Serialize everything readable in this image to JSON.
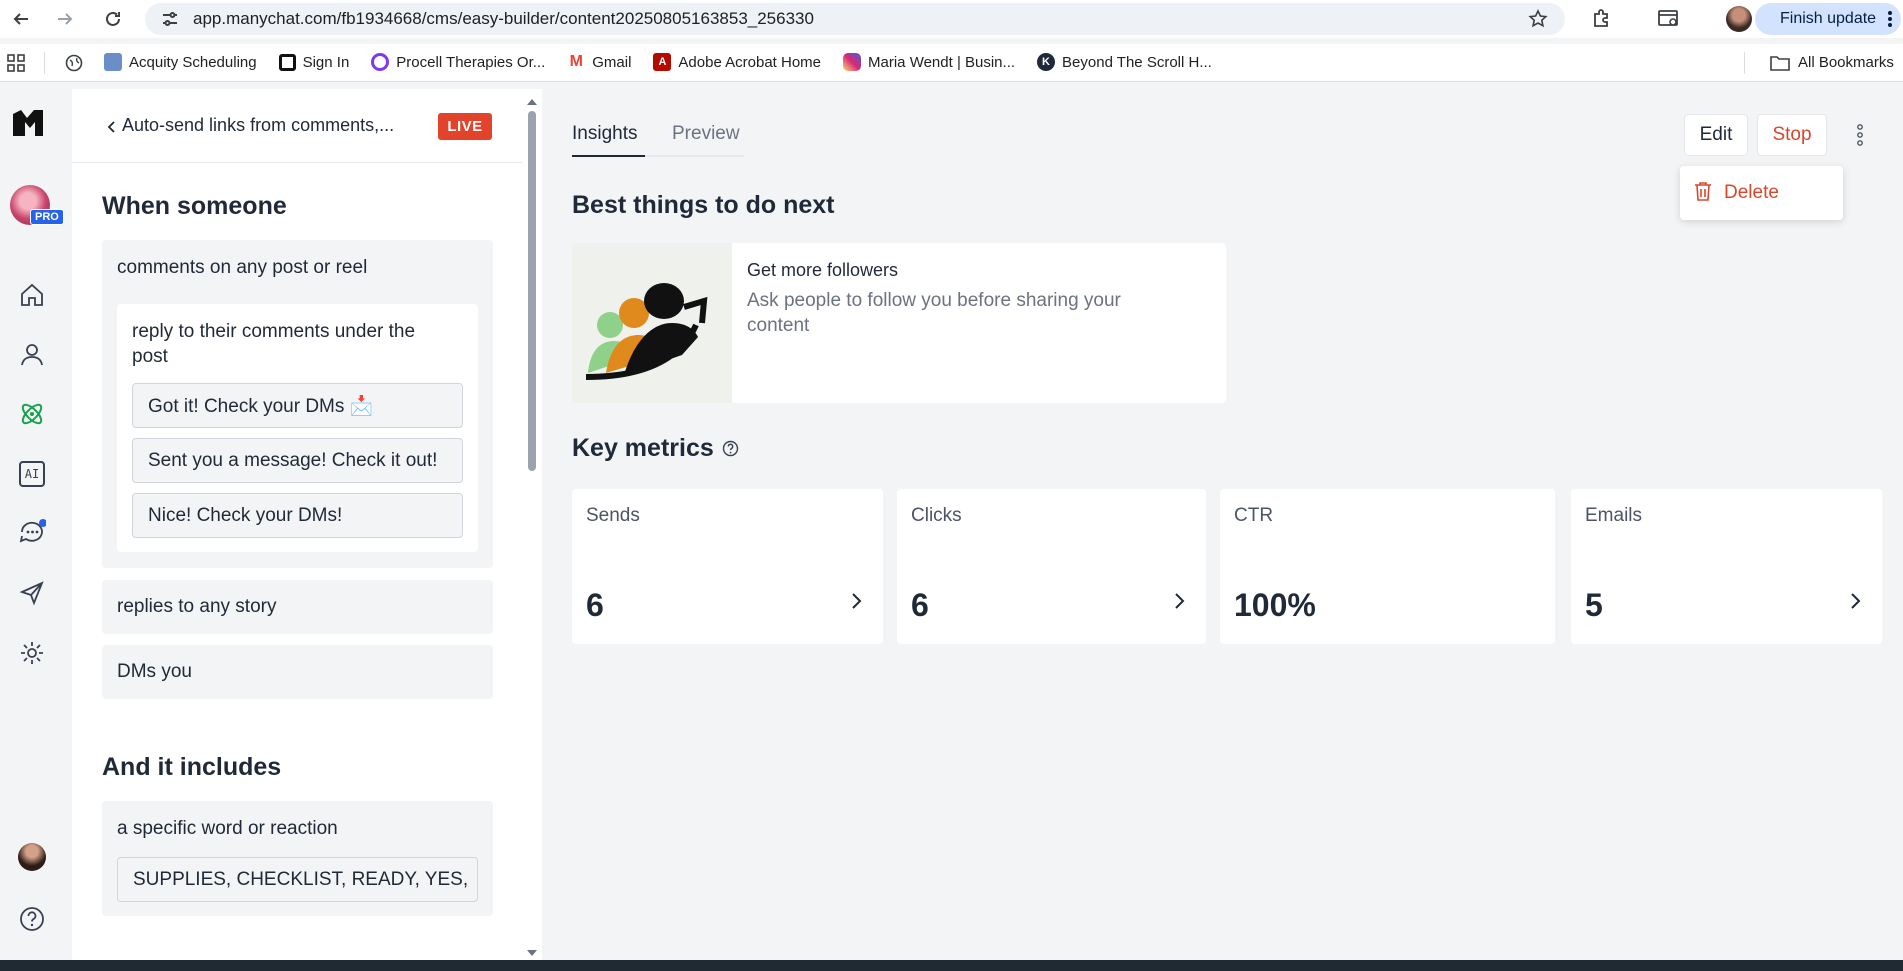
{
  "browser": {
    "url": "app.manychat.com/fb1934668/cms/easy-builder/content20250805163853_256330",
    "finish_update": "Finish update",
    "bookmarks": [
      {
        "label": "Acquity Scheduling",
        "color": "#6b8ec9"
      },
      {
        "label": "Sign In",
        "color": "#111111"
      },
      {
        "label": "Procell Therapies Or...",
        "color": "#7c3aed"
      },
      {
        "label": "Gmail",
        "color": "#ea4335"
      },
      {
        "label": "Adobe Acrobat Home",
        "color": "#b30b00"
      },
      {
        "label": "Maria Wendt | Busin...",
        "color": "#d62976"
      },
      {
        "label": "Beyond The Scroll H...",
        "color": "#1e293b"
      }
    ],
    "all_bookmarks": "All Bookmarks"
  },
  "rail": {
    "pro_badge": "PRO",
    "ai_label": "AI"
  },
  "left_panel": {
    "title": "Auto-send links from comments,...",
    "live": "LIVE",
    "when_heading": "When someone",
    "trigger_comments": "comments on any post or reel",
    "reply_heading": "reply to their comments under the post",
    "replies": [
      "Got it! Check your DMs 📩",
      "Sent you a message! Check it out!",
      "Nice! Check your DMs!"
    ],
    "trigger_story": "replies to any story",
    "trigger_dm": "DMs you",
    "includes_heading": "And it includes",
    "includes_text": "a specific word or reaction",
    "keywords": "SUPPLIES, CHECKLIST, READY, YES,"
  },
  "main": {
    "tabs": [
      {
        "label": "Insights",
        "active": true
      },
      {
        "label": "Preview",
        "active": false
      }
    ],
    "edit": "Edit",
    "stop": "Stop",
    "delete": "Delete",
    "best_heading": "Best things to do next",
    "reco_title": "Get more followers",
    "reco_desc": "Ask people to follow you before sharing your content",
    "metrics_heading": "Key metrics",
    "metrics": [
      {
        "label": "Sends",
        "value": "6"
      },
      {
        "label": "Clicks",
        "value": "6"
      },
      {
        "label": "CTR",
        "value": "100%"
      },
      {
        "label": "Emails",
        "value": "5"
      }
    ]
  },
  "colors": {
    "live": "#e1442a",
    "danger": "#d9472b",
    "accent_green": "#16a34a"
  }
}
